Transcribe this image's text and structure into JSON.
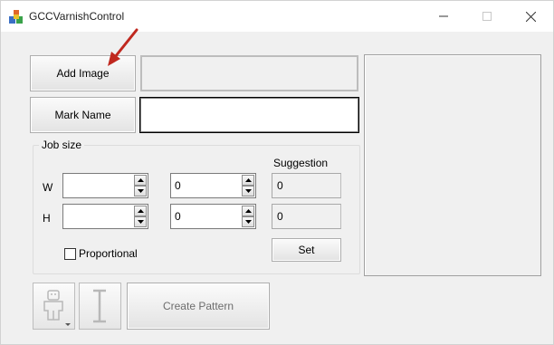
{
  "window": {
    "title": "GCCVarnishControl",
    "controls": [
      "minimize-icon",
      "maximize-icon",
      "close-icon"
    ]
  },
  "image_section": {
    "add_image_label": "Add Image",
    "image_name_value": "",
    "mark_name_label": "Mark Name",
    "mark_name_value": ""
  },
  "job_size": {
    "group_label": "Job size",
    "suggestion_label": "Suggestion",
    "w_label": "W",
    "h_label": "H",
    "w_value_1": "",
    "w_value_2": "0",
    "h_value_1": "",
    "h_value_2": "0",
    "suggestion_w": "0",
    "suggestion_h": "0",
    "set_label": "Set",
    "proportional_label": "Proportional",
    "proportional_checked": false
  },
  "bottom": {
    "robot_icon": "robot-dropdown-icon",
    "text_icon": "text-cursor-icon",
    "create_pattern_label": "Create Pattern"
  },
  "annotation": {
    "arrow_color": "#c0281f"
  }
}
